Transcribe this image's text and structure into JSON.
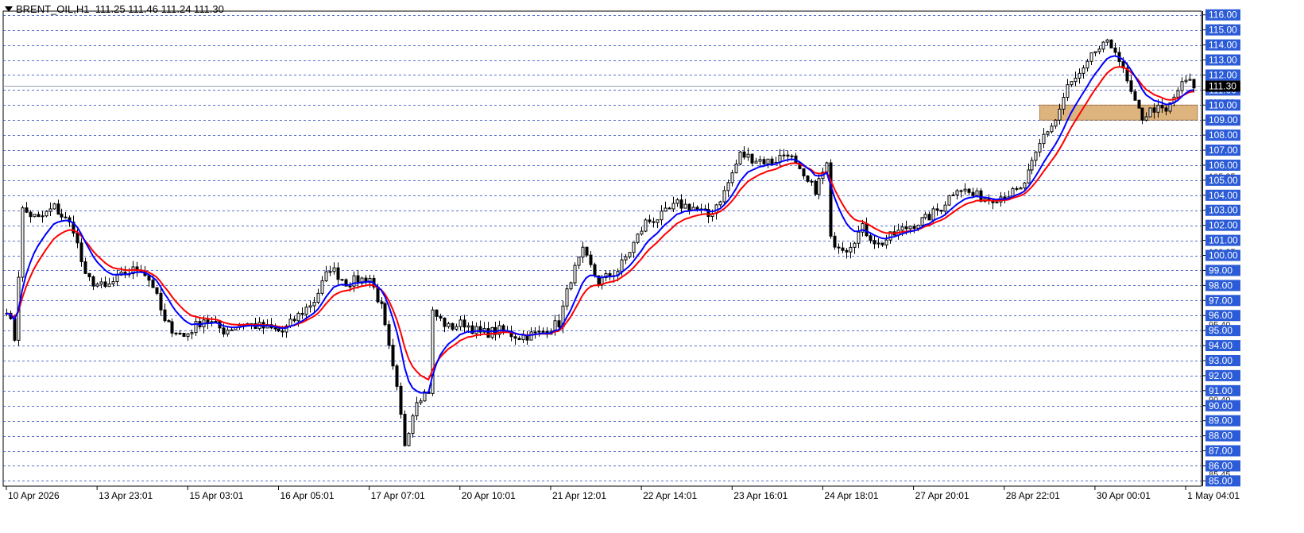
{
  "header": {
    "symbol": "BRENT_OIL,H1",
    "ohlc": "111.25 111.46 111.24 111.30"
  },
  "colors": {
    "background": "#ffffff",
    "grid": "#1f3fbf",
    "label_bg": "#2b5bd7",
    "label_text": "#ffffff",
    "current_price_bg": "#000000",
    "ma_fast": "#0000ff",
    "ma_slow": "#ff0000",
    "zone_fill": "#d9a868",
    "candle": "#000000"
  },
  "chart_data": {
    "type": "candlestick",
    "title": "BRENT_OIL,H1",
    "ylim": [
      84.65,
      116.25
    ],
    "grid": true,
    "price_labels": [
      "116.00",
      "115.00",
      "114.00",
      "113.00",
      "112.00",
      "111.00",
      "110.00",
      "109.00",
      "108.00",
      "107.00",
      "106.00",
      "105.00",
      "104.00",
      "103.00",
      "102.00",
      "101.00",
      "100.00",
      "99.00",
      "98.00",
      "97.00",
      "96.00",
      "95.00",
      "94.00",
      "93.00",
      "92.00",
      "91.00",
      "90.00",
      "89.00",
      "88.00",
      "87.00",
      "86.00",
      "85.00"
    ],
    "price_label_values": [
      116,
      115,
      114,
      113,
      112,
      111,
      110,
      109,
      108,
      107,
      106,
      105,
      104,
      103,
      102,
      101,
      100,
      99,
      98,
      97,
      96,
      95,
      94,
      93,
      92,
      91,
      90,
      89,
      88,
      87,
      86,
      85
    ],
    "faint_levels": [
      "115.20",
      "110.20",
      "105.25",
      "100.25",
      "95.40",
      "90.40",
      "85.45"
    ],
    "faint_level_values": [
      115.2,
      110.2,
      105.25,
      100.25,
      95.4,
      90.4,
      85.45
    ],
    "current_price": "111.30",
    "current_price_value": 111.3,
    "x_labels": [
      "10 Apr 2026",
      "13 Apr 23:01",
      "15 Apr 03:01",
      "16 Apr 05:01",
      "17 Apr 07:01",
      "20 Apr 10:01",
      "21 Apr 12:01",
      "22 Apr 14:01",
      "23 Apr 16:01",
      "24 Apr 18:01",
      "27 Apr 20:01",
      "28 Apr 22:01",
      "30 Apr 00:01",
      "1 May 04:01"
    ],
    "x_label_bars": [
      0,
      23,
      46,
      69,
      92,
      115,
      138,
      161,
      184,
      207,
      230,
      253,
      276,
      299
    ],
    "bar_count": 302,
    "zone": {
      "from_bar": 262,
      "to_bar": 302,
      "low": 109.0,
      "high": 110.0
    },
    "anchors": [
      {
        "bar": 0,
        "price": 96.5
      },
      {
        "bar": 2,
        "price": 94.5
      },
      {
        "bar": 4,
        "price": 103.0
      },
      {
        "bar": 8,
        "price": 102.4
      },
      {
        "bar": 12,
        "price": 103.2
      },
      {
        "bar": 17,
        "price": 101.8
      },
      {
        "bar": 20,
        "price": 98.5
      },
      {
        "bar": 25,
        "price": 97.8
      },
      {
        "bar": 30,
        "price": 98.8
      },
      {
        "bar": 34,
        "price": 99.2
      },
      {
        "bar": 37,
        "price": 98.0
      },
      {
        "bar": 40,
        "price": 95.5
      },
      {
        "bar": 45,
        "price": 94.6
      },
      {
        "bar": 50,
        "price": 95.8
      },
      {
        "bar": 55,
        "price": 95.0
      },
      {
        "bar": 60,
        "price": 95.5
      },
      {
        "bar": 65,
        "price": 95.2
      },
      {
        "bar": 70,
        "price": 94.9
      },
      {
        "bar": 74,
        "price": 96.0
      },
      {
        "bar": 78,
        "price": 97.0
      },
      {
        "bar": 82,
        "price": 99.2
      },
      {
        "bar": 86,
        "price": 98.2
      },
      {
        "bar": 92,
        "price": 98.5
      },
      {
        "bar": 95,
        "price": 96.5
      },
      {
        "bar": 99,
        "price": 91.0
      },
      {
        "bar": 101,
        "price": 87.5
      },
      {
        "bar": 104,
        "price": 90.5
      },
      {
        "bar": 107,
        "price": 91.0
      },
      {
        "bar": 108,
        "price": 96.2
      },
      {
        "bar": 112,
        "price": 95.2
      },
      {
        "bar": 116,
        "price": 95.5
      },
      {
        "bar": 120,
        "price": 94.8
      },
      {
        "bar": 125,
        "price": 95.0
      },
      {
        "bar": 130,
        "price": 94.6
      },
      {
        "bar": 135,
        "price": 94.8
      },
      {
        "bar": 140,
        "price": 95.5
      },
      {
        "bar": 143,
        "price": 98.5
      },
      {
        "bar": 146,
        "price": 100.2
      },
      {
        "bar": 150,
        "price": 98.2
      },
      {
        "bar": 155,
        "price": 99.0
      },
      {
        "bar": 158,
        "price": 100.3
      },
      {
        "bar": 162,
        "price": 102.2
      },
      {
        "bar": 166,
        "price": 102.6
      },
      {
        "bar": 170,
        "price": 103.4
      },
      {
        "bar": 174,
        "price": 103.2
      },
      {
        "bar": 178,
        "price": 102.6
      },
      {
        "bar": 182,
        "price": 104.2
      },
      {
        "bar": 186,
        "price": 106.7
      },
      {
        "bar": 190,
        "price": 106.4
      },
      {
        "bar": 194,
        "price": 106.2
      },
      {
        "bar": 198,
        "price": 106.9
      },
      {
        "bar": 202,
        "price": 105.0
      },
      {
        "bar": 205,
        "price": 104.4
      },
      {
        "bar": 208,
        "price": 106.0
      },
      {
        "bar": 209,
        "price": 101.0
      },
      {
        "bar": 213,
        "price": 100.5
      },
      {
        "bar": 217,
        "price": 101.8
      },
      {
        "bar": 221,
        "price": 100.7
      },
      {
        "bar": 225,
        "price": 101.4
      },
      {
        "bar": 229,
        "price": 102.0
      },
      {
        "bar": 233,
        "price": 102.4
      },
      {
        "bar": 237,
        "price": 103.2
      },
      {
        "bar": 241,
        "price": 104.6
      },
      {
        "bar": 245,
        "price": 104.0
      },
      {
        "bar": 249,
        "price": 103.8
      },
      {
        "bar": 253,
        "price": 104.0
      },
      {
        "bar": 257,
        "price": 104.3
      },
      {
        "bar": 260,
        "price": 106.0
      },
      {
        "bar": 263,
        "price": 108.0
      },
      {
        "bar": 266,
        "price": 109.0
      },
      {
        "bar": 269,
        "price": 111.2
      },
      {
        "bar": 273,
        "price": 112.2
      },
      {
        "bar": 276,
        "price": 113.6
      },
      {
        "bar": 279,
        "price": 114.0
      },
      {
        "bar": 281,
        "price": 113.8
      },
      {
        "bar": 283,
        "price": 112.2
      },
      {
        "bar": 286,
        "price": 110.0
      },
      {
        "bar": 288,
        "price": 109.2
      },
      {
        "bar": 291,
        "price": 109.8
      },
      {
        "bar": 294,
        "price": 109.5
      },
      {
        "bar": 297,
        "price": 111.0
      },
      {
        "bar": 299,
        "price": 111.6
      },
      {
        "bar": 301,
        "price": 111.3
      }
    ],
    "series": [
      {
        "name": "",
        "color": "#0000ff",
        "values_note": ""
      },
      {
        "name": "",
        "color": "#ff0000",
        "values_note": ""
      }
    ]
  }
}
